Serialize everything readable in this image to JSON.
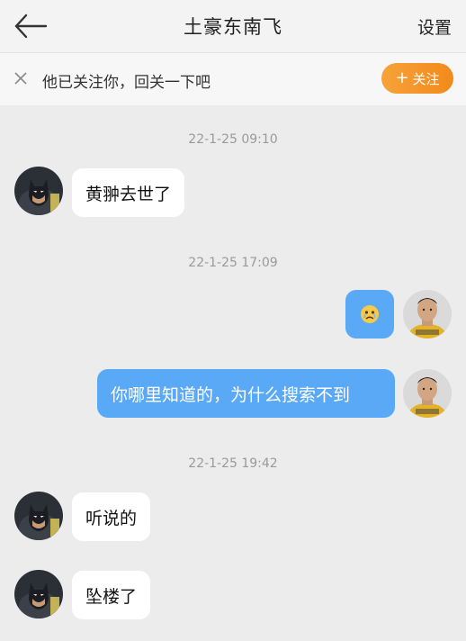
{
  "header": {
    "title": "土豪东南飞",
    "settings_label": "设置",
    "icons": {
      "back": "back-arrow-icon"
    }
  },
  "notice": {
    "text": "他已关注你，回关一下吧",
    "follow_label": "关注",
    "icons": {
      "close": "close-icon",
      "plus": "plus-icon"
    },
    "accent": "#f28a1c"
  },
  "timestamps": [
    "22-1-25 09:10",
    "22-1-25 17:09",
    "22-1-25 19:42"
  ],
  "messages": [
    {
      "side": "left",
      "text": "黄翀去世了"
    },
    {
      "side": "right",
      "type": "emoji",
      "emoji": "sad-face-emoji"
    },
    {
      "side": "right",
      "text": "你哪里知道的，为什么搜索不到"
    },
    {
      "side": "left",
      "text": "听说的"
    },
    {
      "side": "left",
      "text": "坠楼了"
    }
  ],
  "colors": {
    "bubble_right": "#5aa9f6",
    "bubble_left": "#ffffff",
    "background": "#ececec"
  }
}
